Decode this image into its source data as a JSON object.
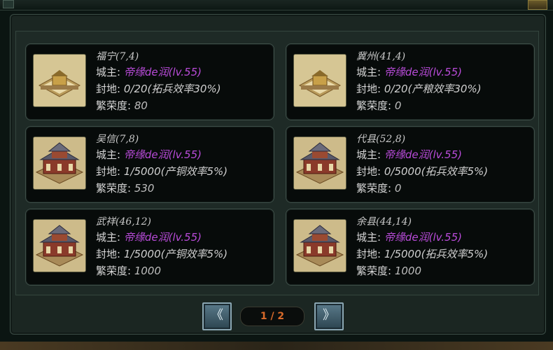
{
  "labels": {
    "lord": "城主:",
    "fief": "封地:",
    "prosperity": "繁荣度:"
  },
  "colors": {
    "lord_name": "#b84bd8",
    "page_indicator": "#d86a2a",
    "card_bg": "#070b0a"
  },
  "cities": [
    {
      "name": "福宁(7,4)",
      "lord": "帝缘de润(lv.55)",
      "fief": "0/20(拓兵效率30%)",
      "prosperity": "80",
      "icon": "small-courtyard-icon"
    },
    {
      "name": "冀州(41,4)",
      "lord": "帝缘de润(lv.55)",
      "fief": "0/20(产粮效率30%)",
      "prosperity": "0",
      "icon": "small-courtyard-icon"
    },
    {
      "name": "吴信(7,8)",
      "lord": "帝缘de润(lv.55)",
      "fief": "1/5000(产铜效率5%)",
      "prosperity": "530",
      "icon": "palace-icon"
    },
    {
      "name": "代县(52,8)",
      "lord": "帝缘de润(lv.55)",
      "fief": "0/5000(拓兵效率5%)",
      "prosperity": "0",
      "icon": "palace-icon"
    },
    {
      "name": "武祥(46,12)",
      "lord": "帝缘de润(lv.55)",
      "fief": "1/5000(产铜效率5%)",
      "prosperity": "1000",
      "icon": "palace-icon"
    },
    {
      "name": "余县(44,14)",
      "lord": "帝缘de润(lv.55)",
      "fief": "1/5000(拓兵效率5%)",
      "prosperity": "1000",
      "icon": "palace-icon"
    }
  ],
  "pagination": {
    "prev_icon": "double-chevron-left-icon",
    "next_icon": "double-chevron-right-icon",
    "prev_glyph": "《",
    "next_glyph": "》",
    "indicator": "1 / 2"
  }
}
